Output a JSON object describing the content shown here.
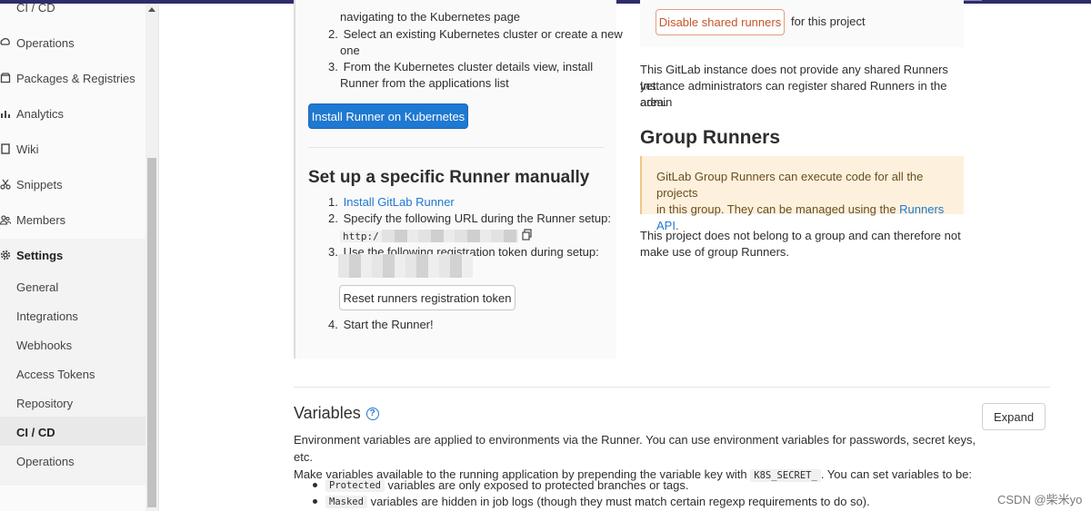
{
  "sidebar": {
    "top_partial": "CI / CD",
    "items": [
      {
        "label": "Operations",
        "icon": "cloud-gear-icon"
      },
      {
        "label": "Packages & Registries",
        "icon": "package-icon"
      },
      {
        "label": "Analytics",
        "icon": "chart-icon"
      },
      {
        "label": "Wiki",
        "icon": "book-icon"
      },
      {
        "label": "Snippets",
        "icon": "scissors-icon"
      },
      {
        "label": "Members",
        "icon": "users-icon"
      },
      {
        "label": "Settings",
        "icon": "gear-icon"
      }
    ],
    "settings_sub": [
      "General",
      "Integrations",
      "Webhooks",
      "Access Tokens",
      "Repository",
      "CI / CD",
      "Operations"
    ]
  },
  "kubernetes": {
    "step1_tail": "navigating to the Kubernetes page",
    "step2_a": "Select an existing Kubernetes cluster or create a new",
    "step2_b": "one",
    "step3_a": "From the Kubernetes cluster details view, install",
    "step3_b": "Runner from the applications list",
    "install_button": "Install Runner on Kubernetes"
  },
  "specific_runner": {
    "title": "Set up a specific Runner manually",
    "step1_link": "Install GitLab Runner",
    "step2": "Specify the following URL during the Runner setup:",
    "url_prefix": "http:/",
    "step3": "Use the following registration token during setup:",
    "reset_button": "Reset runners registration token",
    "step4": "Start the Runner!"
  },
  "shared_runners": {
    "disable_button": "Disable shared runners",
    "for_project": "for this project",
    "note_1": "This GitLab instance does not provide any shared Runners yet.",
    "note_2": "Instance administrators can register shared Runners in the admin",
    "note_3": "area."
  },
  "group_runners": {
    "title": "Group Runners",
    "alert_1": "GitLab Group Runners can execute code for all the projects",
    "alert_2_pre": "in this group. They can be managed using the ",
    "alert_2_link": "Runners API",
    "alert_2_post": ".",
    "note_1": "This project does not belong to a group and can therefore not",
    "note_2": "make use of group Runners."
  },
  "variables": {
    "title": "Variables",
    "expand_button": "Expand",
    "desc_1": "Environment variables are applied to environments via the Runner. You can use environment variables for passwords, secret keys, etc.",
    "desc_2_pre": "Make variables available to the running application by prepending the variable key with ",
    "desc_2_code": "K8S_SECRET_",
    "desc_2_post": ". You can set variables to be:",
    "bullet1_code": "Protected",
    "bullet1_text": "variables are only exposed to protected branches or tags.",
    "bullet2_code": "Masked",
    "bullet2_text": "variables are hidden in job logs (though they must match certain regexp requirements to do so)."
  },
  "watermark": "CSDN @柴米yo",
  "colors": {
    "primary": "#1f78d1",
    "warning_bg": "#fdf1dd",
    "danger_text": "#c4552a"
  }
}
